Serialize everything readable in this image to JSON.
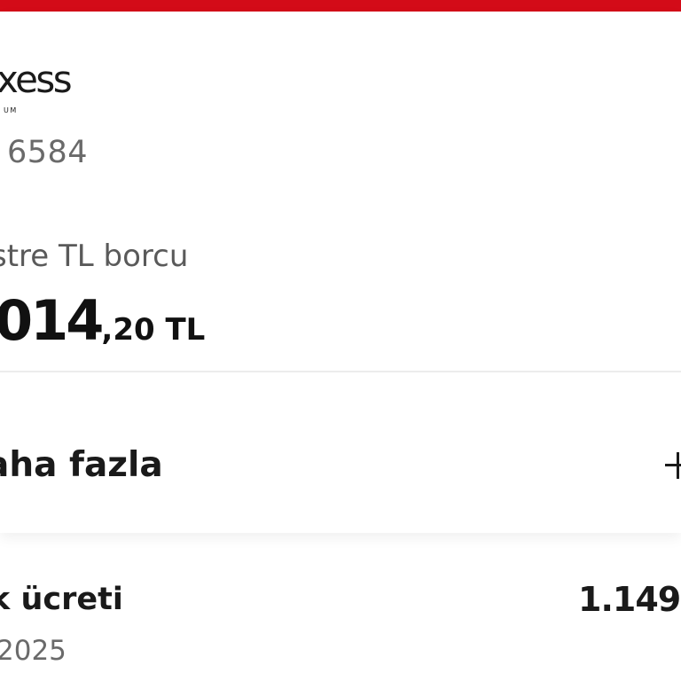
{
  "card": {
    "brand_logo": "xess",
    "brand_sub": "UM",
    "number_tail": "6584",
    "debt_label": "stre TL borcu",
    "debt_amount_main": "014",
    "debt_amount_fraction": ",20 TL"
  },
  "more": {
    "label": "aha fazla",
    "icon": "plus-icon"
  },
  "transaction": {
    "title": "k ücreti",
    "amount": "1.149,",
    "date": "2025"
  },
  "colors": {
    "top_bar": "#d30b18",
    "text_primary": "#111111",
    "text_secondary": "#6a6a6a"
  }
}
